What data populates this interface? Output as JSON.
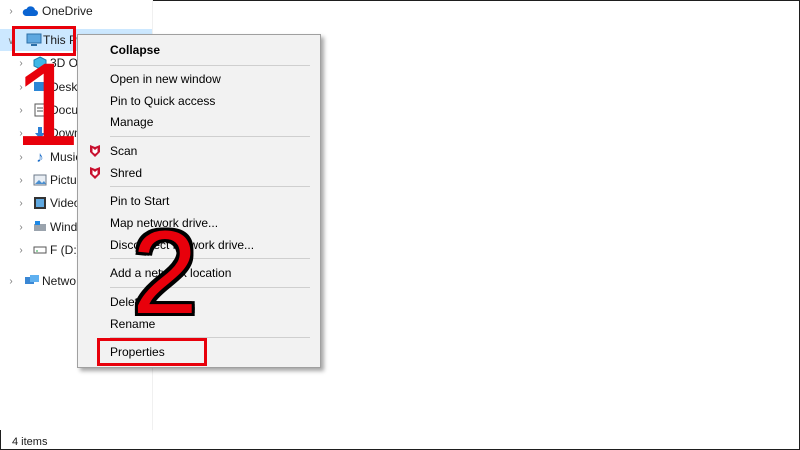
{
  "nav": {
    "onedrive": "OneDrive",
    "this_pc": "This PC",
    "items": [
      {
        "label": "3D O",
        "icon": "3d-objects-icon"
      },
      {
        "label": "Desk",
        "icon": "desktop-icon"
      },
      {
        "label": "Docu",
        "icon": "documents-icon"
      },
      {
        "label": "Down",
        "icon": "downloads-icon"
      },
      {
        "label": "Music",
        "icon": "music-icon"
      },
      {
        "label": "Pictu",
        "icon": "pictures-icon"
      },
      {
        "label": "Video",
        "icon": "videos-icon"
      },
      {
        "label": "Wind",
        "icon": "windows-drive-icon"
      },
      {
        "label": "F (D:)",
        "icon": "drive-icon"
      }
    ],
    "network": "Netwo"
  },
  "status": {
    "items_count": "4 items"
  },
  "context_menu": {
    "collapse": "Collapse",
    "open_new_window": "Open in new window",
    "pin_quick_access": "Pin to Quick access",
    "manage": "Manage",
    "scan": "Scan",
    "shred": "Shred",
    "pin_to_start": "Pin to Start",
    "map_network_drive": "Map network drive...",
    "disconnect_network_drive": "Disconnect network drive...",
    "add_network_location": "Add a network location",
    "delete": "Delete",
    "rename": "Rename",
    "properties": "Properties"
  },
  "annotations": {
    "step1": "1",
    "step2": "2"
  },
  "colors": {
    "annotation_red": "#e8000b",
    "selection_blue": "#cce8ff",
    "mcafee_red": "#c8102e"
  }
}
